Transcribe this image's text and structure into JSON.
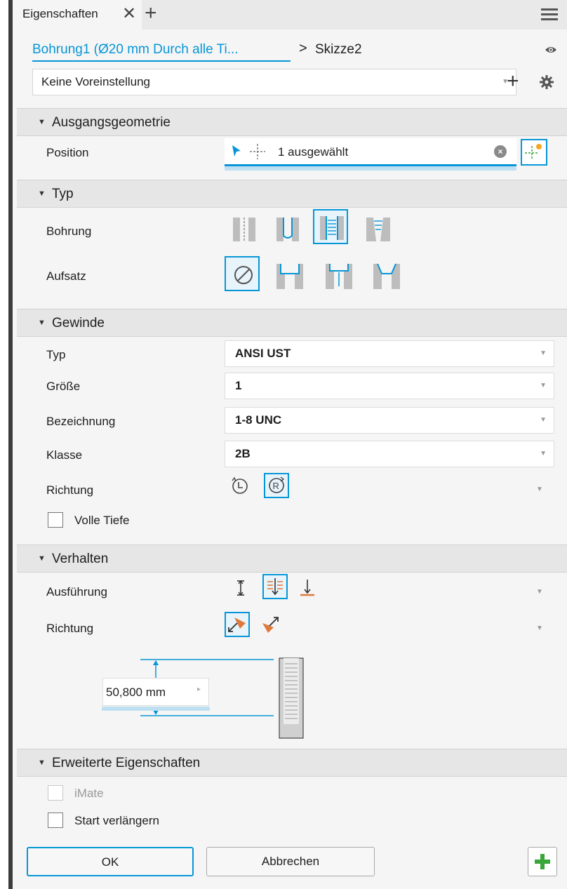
{
  "tabs": {
    "title": "Eigenschaften",
    "close_icon": "close-icon",
    "add_icon": "plus-icon",
    "menu_icon": "hamburger-menu-icon"
  },
  "breadcrumb": {
    "feature": "Bohrung1 (Ø20 mm Durch alle Ti...",
    "separator": ">",
    "sketch": "Skizze2",
    "visibility_icon": "eye-icon"
  },
  "preset": {
    "value": "Keine Voreinstellung",
    "add_icon": "plus-icon",
    "settings_icon": "gear-icon"
  },
  "sections": {
    "input_geometry": {
      "title": "Ausgangsgeometrie",
      "position_label": "Position",
      "position_value": "1 ausgewählt"
    },
    "type": {
      "title": "Typ",
      "hole_label": "Bohrung",
      "hole_options": [
        "simple-hole-icon",
        "clearance-hole-icon",
        "tapped-hole-icon",
        "taper-tapped-hole-icon"
      ],
      "hole_selected": 2,
      "seat_label": "Aufsatz",
      "seat_options": [
        "no-seat-icon",
        "counterbore-icon",
        "spotface-icon",
        "countersink-icon"
      ],
      "seat_selected": 0
    },
    "thread": {
      "title": "Gewinde",
      "type_label": "Typ",
      "type_value": "ANSI UST",
      "size_label": "Größe",
      "size_value": "1",
      "designation_label": "Bezeichnung",
      "designation_value": "1-8 UNC",
      "class_label": "Klasse",
      "class_value": "2B",
      "direction_label": "Richtung",
      "direction_options": [
        "left-hand-thread-icon",
        "right-hand-thread-icon"
      ],
      "direction_selected": 1,
      "full_depth_label": "Volle Tiefe",
      "full_depth_checked": false
    },
    "behavior": {
      "title": "Verhalten",
      "termination_label": "Ausführung",
      "termination_options": [
        "distance-icon",
        "through-all-icon",
        "to-face-icon"
      ],
      "termination_selected": 1,
      "direction_label": "Richtung",
      "direction_options": [
        "default-direction-icon",
        "flip-direction-icon"
      ],
      "direction_selected": 0,
      "depth_value": "50,800 mm"
    },
    "advanced": {
      "title": "Erweiterte Eigenschaften",
      "imate_label": "iMate",
      "imate_enabled": false,
      "extend_start_label": "Start verlängern",
      "extend_start_checked": false
    }
  },
  "buttons": {
    "ok": "OK",
    "cancel": "Abbrechen",
    "add_icon": "plus-icon"
  },
  "colors": {
    "accent": "#0696d7",
    "green": "#3aa63a",
    "orange": "#e07a3c"
  }
}
